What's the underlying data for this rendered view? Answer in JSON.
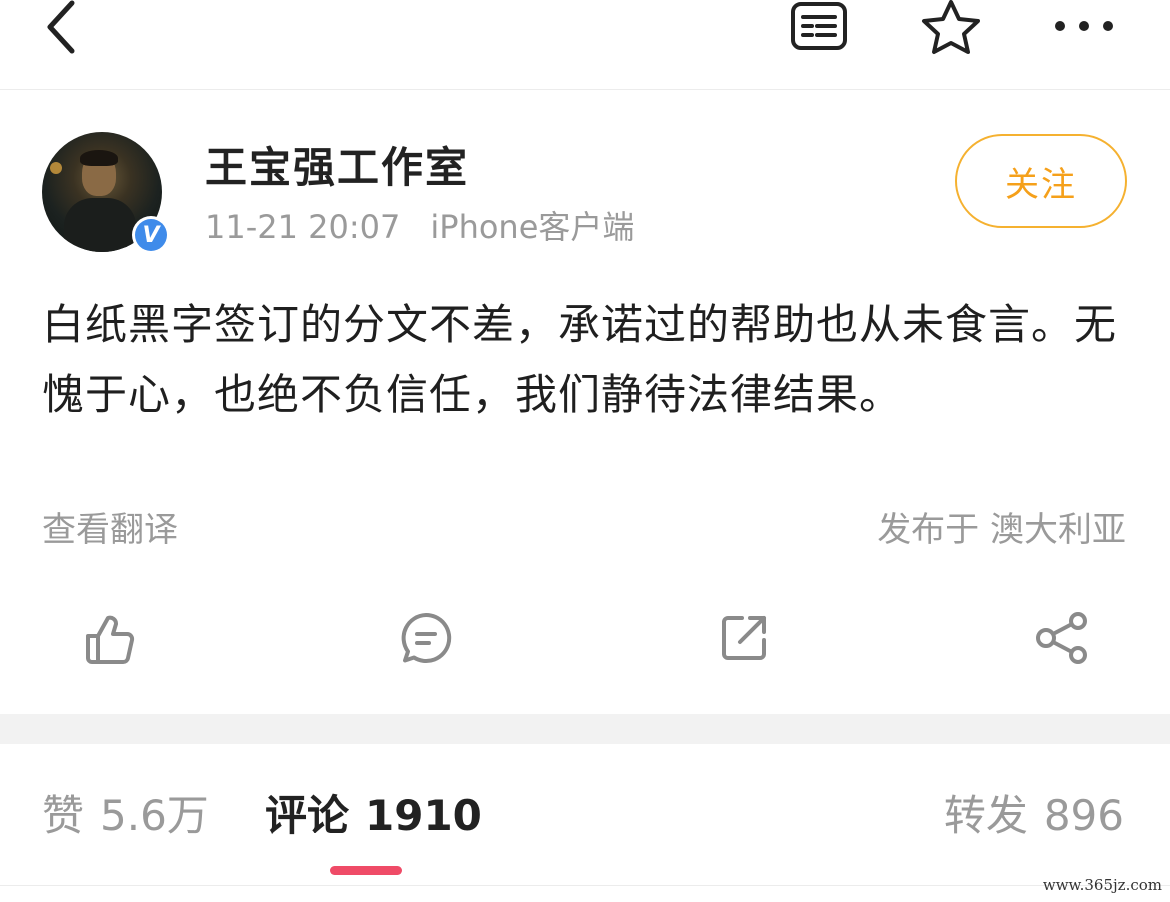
{
  "topbar": {
    "back_icon": "chevron-left-icon",
    "list_icon": "list-icon",
    "star_icon": "star-icon",
    "more_icon": "more-dots-icon"
  },
  "post": {
    "username": "王宝强工作室",
    "verified_badge": "V",
    "timestamp": "11-21 20:07",
    "source": "iPhone客户端",
    "follow_label": "关注",
    "content": "白纸黑字签订的分文不差，承诺过的帮助也从未食言。无愧于心，也绝不负信任，我们静待法律结果。",
    "translate_label": "查看翻译",
    "location": "发布于 澳大利亚"
  },
  "actions": {
    "like_icon": "thumbs-up-icon",
    "comment_icon": "comment-icon",
    "repost_icon": "repost-icon",
    "share_icon": "share-icon"
  },
  "tabs": {
    "like_label": "赞",
    "like_count": "5.6万",
    "comment_label": "评论",
    "comment_count": "1910",
    "repost_label": "转发",
    "repost_count": "896"
  },
  "colors": {
    "follow_accent": "#f5a01a",
    "verified_blue": "#3f8bea",
    "active_tab_underline": "#ef4b67",
    "muted_text": "#9a9a9a"
  },
  "watermark": "www.365jz.com"
}
